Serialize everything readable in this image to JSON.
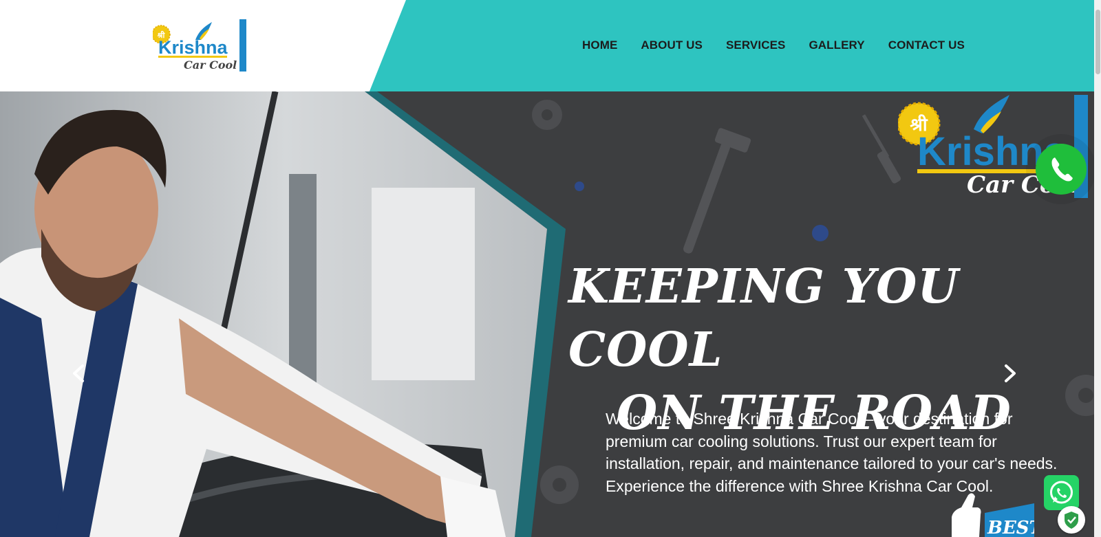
{
  "brand": {
    "badge": "श्री",
    "name": "Krishna",
    "tagline": "Car Cool"
  },
  "nav": {
    "items": [
      "HOME",
      "ABOUT US",
      "SERVICES",
      "GALLERY",
      "CONTACT US"
    ]
  },
  "hero": {
    "headline_line1": "KEEPING YOU COOL",
    "headline_line2": "ON THE ROAD",
    "lead": "Welcome to Shree Krishna Car Cool – your destination for premium car cooling solutions. Trust our expert team for installation, repair, and maintenance tailored to your car's needs. Experience the difference with Shree Krishna Car Cool.",
    "badge_text": "BEST",
    "prev_icon": "chevron-left-icon",
    "next_icon": "chevron-right-icon"
  },
  "floating": {
    "call_icon": "phone-icon",
    "whatsapp_icon": "whatsapp-icon",
    "shield_icon": "shield-check-icon"
  },
  "colors": {
    "header_teal": "#2ec4c0",
    "hero_bg": "#3d3e40",
    "accent_blue": "#1e88c9",
    "call_green": "#1fbe3b",
    "whatsapp_green": "#25d366",
    "logo_yellow": "#f2c811"
  }
}
